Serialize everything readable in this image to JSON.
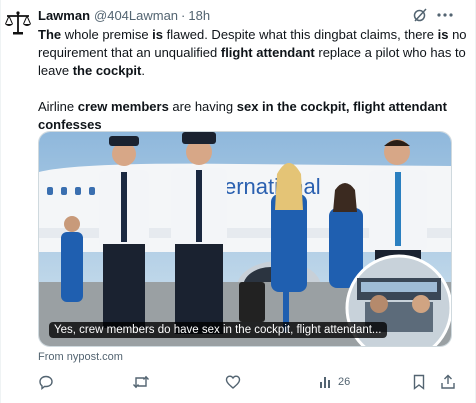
{
  "author": {
    "name": "Lawman",
    "handle": "@404Lawman",
    "time": "18h",
    "separator": "·",
    "avatar_icon": "scales-of-justice-icon"
  },
  "post": {
    "p1_a": "The",
    "p1_b": " whole premise ",
    "p1_c": "is",
    "p1_d": " flawed. Despite what this dingbat claims, there ",
    "p1_e": "is",
    "p1_f": " no requirement that an unqualified ",
    "p1_g": "flight attendant",
    "p1_h": " replace a pilot who has to leave ",
    "p1_i": "the cockpit",
    "p1_j": ".",
    "p2_a": "Airline ",
    "p2_b": "crew members",
    "p2_c": " are having ",
    "p2_d": "sex in the cockpit, flight attendant confesses"
  },
  "card": {
    "caption": "Yes, crew members do have sex in the cockpit, flight attendant...",
    "source": "From nypost.com"
  },
  "actions": {
    "reply_count": "",
    "repost_count": "",
    "like_count": "",
    "views_count": "26"
  },
  "colors": {
    "text": "#0f1419",
    "muted": "#536471",
    "sky": "#a9cbe4",
    "uniform_blue": "#1f5fb0"
  }
}
